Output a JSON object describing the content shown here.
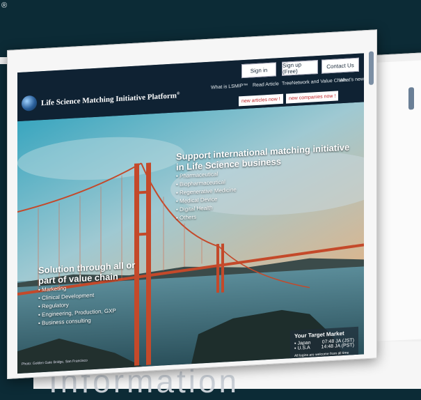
{
  "corner_mark": "®",
  "nav": {
    "buttons": [
      "Sign in",
      "Sign up (Free)",
      "Contact Us"
    ],
    "links": [
      "What is LSMIP™",
      "Read Article",
      "TreeNetwork and Value Chain",
      "What's new"
    ],
    "badges": [
      "new articles now !",
      "new companies now !"
    ]
  },
  "site_title": "Life Science Matching Initiative Platform",
  "site_title_mark": "®",
  "hero": {
    "heading": [
      "Support international matching initiative",
      "in Life Science business"
    ],
    "items": [
      "Pharmaceutical",
      "Biopharmaceutical",
      "Regenerative Medicine",
      "Medical Device",
      "Digital Health",
      "Others"
    ],
    "solution_heading": [
      "Solution through all or",
      "part of value chain"
    ],
    "solution_items": [
      "Marketing",
      "Clinical Development",
      "Regulatory",
      "Engineering, Production, GXP",
      "Business consulting"
    ],
    "photo_credit": "Photo: Golden Gate Bridge, San Francisco"
  },
  "market": {
    "title": "Your Target Market",
    "rows": [
      {
        "label": "Japan",
        "value": "07:48 JA (JST)"
      },
      {
        "label": "U.S.A",
        "value": "14:48 JA (PST)"
      }
    ],
    "note": "All logins are welcome from all time zones"
  },
  "bottom_text": "Information",
  "colors": {
    "page_bg": "#0c2b36",
    "header_bg": "#0f2233",
    "badge_red": "#c0262a",
    "bridge": "#c4492a"
  }
}
